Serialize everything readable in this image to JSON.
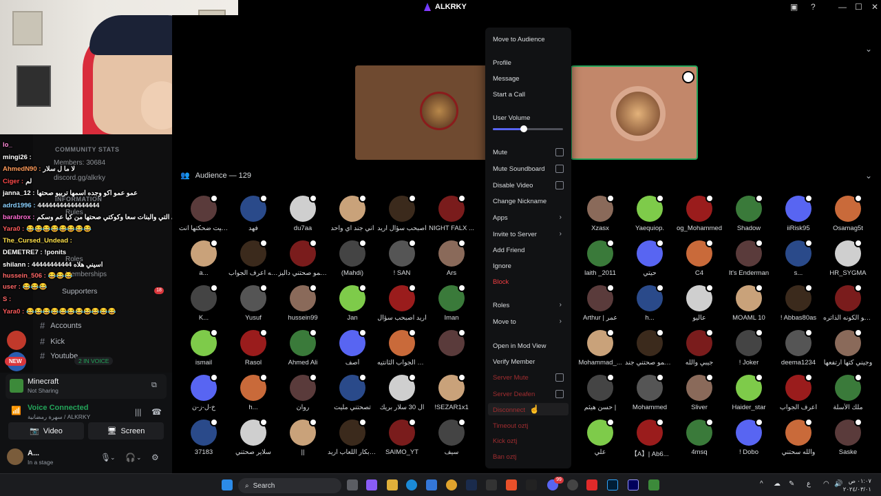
{
  "window": {
    "title": "ALKRKY"
  },
  "sidebar": {
    "categories": [
      "COMMUNITY STATS",
      "Members: 30684",
      "discord.gg/alkrky",
      "INFORMATION",
      "Rules",
      "Roles",
      "Memberships"
    ],
    "supporters": {
      "label": "Supporters",
      "count": "18"
    },
    "channels": [
      "Accounts",
      "Kick",
      "Youtube"
    ],
    "in_voice": "2 IN VOICE",
    "new_badge": "NEW",
    "chat": [
      {
        "user": "lo_",
        "msg": "",
        "color": "#ff8ad8"
      },
      {
        "user": "mingi26 :",
        "msg": "",
        "color": "#ffffff"
      },
      {
        "user": "AhmedN90 :",
        "msg": "لا ما ل سلار",
        "color": "#ff9b5a"
      },
      {
        "user": "Ciger :",
        "msg": "لم",
        "color": "#ff4a4a"
      },
      {
        "user": "janna_12 :",
        "msg": "عمو عمو اكو وجده اسمها تربيو صحتها",
        "color": "#ffffff"
      },
      {
        "user": "adrd1996 :",
        "msg": "44444444444444444",
        "color": "#8ad0ff"
      },
      {
        "user": "barabrox :",
        "msg": "ابي التي والبنات سعا وكوكتي صحتها من كيا عم وسكم",
        "color": "#ff6bd3"
      },
      {
        "user": "Yara0 :",
        "msg": "😂😂😂😂😂😂😂😂",
        "color": "#ff5b5b"
      },
      {
        "user": "The_Cursed_Undead :",
        "msg": "",
        "color": "#ffe14a"
      },
      {
        "user": "DEMETRE7 :",
        "msg": "!ponits",
        "color": "#ffffff"
      },
      {
        "user": "shilann :",
        "msg": "اسيني هلاه 44444444444",
        "color": "#ffffff"
      },
      {
        "user": "hussein_506 :",
        "msg": "😂😂😂",
        "color": "#ff6666"
      },
      {
        "user": "user :",
        "msg": "😂😂😂",
        "color": "#ff6666"
      },
      {
        "user": "S :",
        "msg": "",
        "color": "#ff6666"
      },
      {
        "user": "Yara0 :",
        "msg": "😂😂😂😂😂😂😂😂😂😂😂",
        "color": "#ff5b5b"
      }
    ]
  },
  "panel": {
    "activity": {
      "title": "Minecraft",
      "subtitle": "Not Sharing"
    },
    "voice": {
      "title": "Voice Connected",
      "subtitle": "سهرة رمضانية / ALKRKY"
    },
    "buttons": {
      "video": "Video",
      "screen": "Screen"
    },
    "user": {
      "name": "A...",
      "status": "In a stage"
    }
  },
  "stage": {
    "audience_label": "Audience — 129"
  },
  "members": [
    [
      "حبيت ضحكتها انت...",
      "فهد",
      "du7aa",
      "اني جند اي واحد",
      "اصبحب سؤال اريد",
      "NIGHT FALX ...",
      "",
      "",
      "Xzasx",
      "Yaequiop.",
      "og_Mohammed",
      "Shadow",
      "iiRisk95",
      "Osamag5t"
    ],
    [
      "a...",
      "والله اعرف الجواب !",
      "عمو صحتني داليز !",
      "(Mahdi)",
      "! SAN",
      "Ars",
      "",
      "",
      "laith _2011",
      "حيتي",
      "C4",
      "It's Enderman",
      "s...",
      "HR_SYGMA"
    ],
    [
      "K...",
      "Yusuf",
      "hussein99",
      "Jan",
      "اريد اصبحب سؤال",
      "Iman",
      "",
      "",
      "Arthur | عمر",
      "h...",
      "عاليو",
      "MOAML 10",
      "! Abbas80as",
      "انا هو الكونه الذاتره"
    ],
    [
      "ismail",
      "Rasol",
      "Ahmed Ali",
      "آصف",
      "عف الجواب الثانتيه",
      "",
      "",
      "",
      "Mohammad_...",
      "عمو صحتني جند Ars",
      "جيبي والله",
      "! Joker",
      "deema1234",
      "وجيني كتها ارتفعها"
    ],
    [
      "خ-ل-ز-ن",
      "h...",
      "روان",
      "تصحتني مليت",
      "ال 30 سلار بريك",
      "!SEZAR1x1",
      "",
      "",
      "حسن هيثم |",
      "Mohammed",
      "Sliver",
      "Haider_star",
      "اعرف الجواب",
      "ملك الأسلة"
    ],
    [
      "37183",
      "سلاير صحتني",
      "||",
      "ال فابكار اللعاب اريد",
      "SAIMO_YT",
      "سيف",
      "",
      "",
      "علي",
      "【A】| Ab6...",
      "4msq",
      "! Dobo",
      "والله سحتني",
      "Saske"
    ]
  ],
  "menu": {
    "items": {
      "move_audience": "Move to Audience",
      "profile": "Profile",
      "message": "Message",
      "start_call": "Start a Call",
      "user_volume": "User Volume",
      "mute": "Mute",
      "mute_soundboard": "Mute Soundboard",
      "disable_video": "Disable Video",
      "change_nickname": "Change Nickname",
      "apps": "Apps",
      "invite": "Invite to Server",
      "add_friend": "Add Friend",
      "ignore": "Ignore",
      "block": "Block",
      "roles": "Roles",
      "move_to": "Move to",
      "mod_view": "Open in Mod View",
      "verify": "Verify Member",
      "server_mute": "Server Mute",
      "server_deafen": "Server Deafen",
      "disconnect": "Disconnect",
      "timeout": "Timeout oztj",
      "kick": "Kick oztj",
      "ban": "Ban oztj"
    },
    "volume": 0.44
  },
  "taskbar": {
    "search": "Search",
    "clock_time": "٠١:٠٧ ص",
    "clock_date": "٢٠٢٤/٠٣/٠١",
    "lang": "ع",
    "discord_badge": "99"
  }
}
